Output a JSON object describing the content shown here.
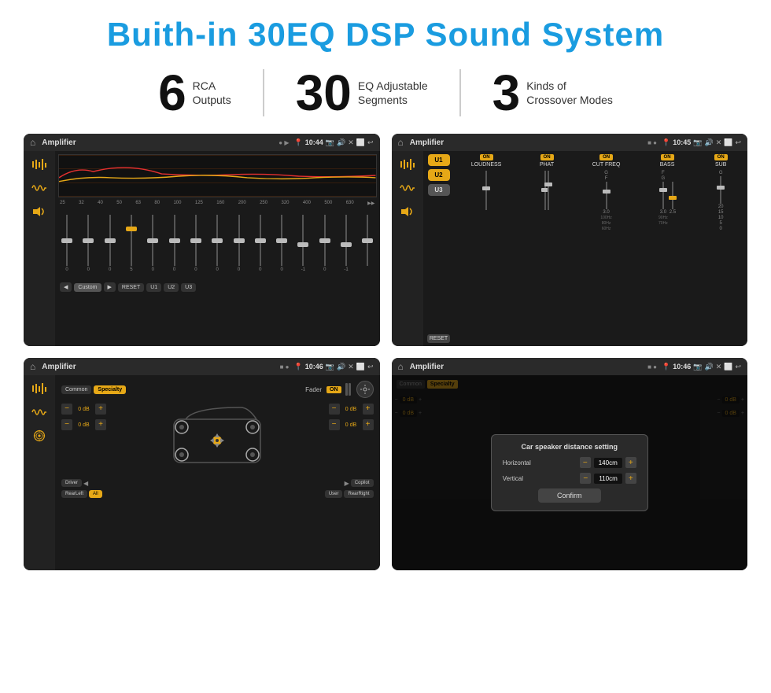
{
  "title": "Buith-in 30EQ DSP Sound System",
  "stats": [
    {
      "number": "6",
      "label_line1": "RCA",
      "label_line2": "Outputs"
    },
    {
      "number": "30",
      "label_line1": "EQ Adjustable",
      "label_line2": "Segments"
    },
    {
      "number": "3",
      "label_line1": "Kinds of",
      "label_line2": "Crossover Modes"
    }
  ],
  "screens": [
    {
      "id": "eq-screen",
      "app_name": "Amplifier",
      "time": "10:44",
      "type": "eq"
    },
    {
      "id": "crossover-screen",
      "app_name": "Amplifier",
      "time": "10:45",
      "type": "crossover"
    },
    {
      "id": "speaker-screen",
      "app_name": "Amplifier",
      "time": "10:46",
      "type": "speaker"
    },
    {
      "id": "dialog-screen",
      "app_name": "Amplifier",
      "time": "10:46",
      "type": "dialog"
    }
  ],
  "eq": {
    "freqs": [
      "25",
      "32",
      "40",
      "50",
      "63",
      "80",
      "100",
      "125",
      "160",
      "200",
      "250",
      "320",
      "400",
      "500",
      "630"
    ],
    "values": [
      "0",
      "0",
      "0",
      "5",
      "0",
      "0",
      "0",
      "0",
      "0",
      "0",
      "0",
      "-1",
      "0",
      "-1",
      ""
    ],
    "presets": [
      "Custom",
      "RESET",
      "U1",
      "U2",
      "U3"
    ]
  },
  "crossover": {
    "presets": [
      "U1",
      "U2",
      "U3"
    ],
    "cols": [
      "LOUDNESS",
      "PHAT",
      "CUT FREQ",
      "BASS",
      "SUB"
    ],
    "reset": "RESET"
  },
  "speaker": {
    "modes": [
      "Common",
      "Specialty"
    ],
    "fader": "Fader",
    "on": "ON",
    "db_controls": [
      "0 dB",
      "0 dB",
      "0 dB",
      "0 dB"
    ],
    "positions": [
      "Driver",
      "Copilot",
      "RearLeft",
      "RearRight"
    ],
    "all": "All",
    "user": "User"
  },
  "dialog": {
    "title": "Car speaker distance setting",
    "horizontal_label": "Horizontal",
    "horizontal_value": "140cm",
    "vertical_label": "Vertical",
    "vertical_value": "110cm",
    "confirm": "Confirm"
  },
  "colors": {
    "accent": "#1a9ce0",
    "gold": "#e6a817",
    "title": "#111111",
    "subtitle": "#333333"
  }
}
